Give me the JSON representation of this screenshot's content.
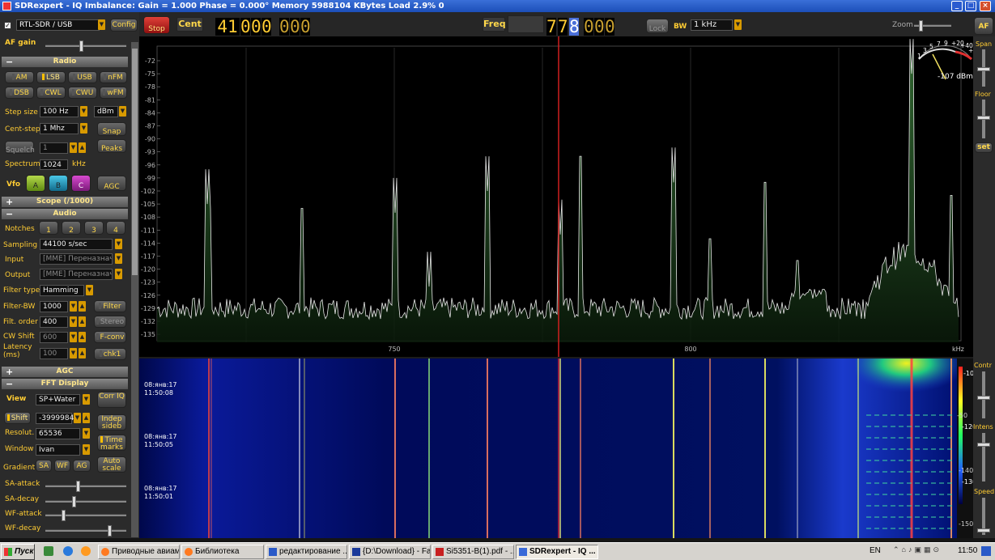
{
  "window": {
    "title": "SDRexpert - IQ Imbalance: Gain = 1.000 Phase = 0.000°   Memory 5988104 KBytes    Load 2.9%  0"
  },
  "toolbar": {
    "device": "RTL-SDR / USB",
    "config": "Config",
    "stop": "Stop",
    "cent_label": "Cent",
    "cent_bright": "41",
    "cent_digits": [
      "0",
      "0",
      "0",
      "0",
      "0",
      "0"
    ],
    "freq_label": "Freq",
    "freq_digits": [
      "7",
      "7",
      "8",
      "0",
      "0",
      "0"
    ],
    "lock": "Lock",
    "bw_label": "BW",
    "bw_value": "1 kHz",
    "zoom_label": "Zoom",
    "af": "AF"
  },
  "left": {
    "af_gain": "AF gain",
    "radio_hdr": "Radio",
    "modes_row1": [
      "AM",
      "LSB",
      "USB",
      "nFM"
    ],
    "modes_row2": [
      "DSB",
      "CWL",
      "CWU",
      "wFM"
    ],
    "step_size_lbl": "Step size",
    "step_size": "100 Hz",
    "unit": "dBm",
    "cent_step_lbl": "Cent-step",
    "cent_step": "1 Mhz",
    "snap": "Snap",
    "squelch": "Squelch",
    "squelch_val": "1",
    "peaks": "Peaks",
    "spectrum_lbl": "Spectrum",
    "spectrum_val": "1024",
    "spectrum_unit": "kHz",
    "vfo_lbl": "Vfo",
    "vfo": [
      "A",
      "B",
      "C"
    ],
    "agc_btn": "AGC",
    "scope_hdr": "Scope (/1000)",
    "audio_hdr": "Audio",
    "notches_lbl": "Notches",
    "notches": [
      "1",
      "2",
      "3",
      "4"
    ],
    "sampling_lbl": "Sampling",
    "sampling": "44100 s/sec",
    "input_lbl": "Input",
    "input": "[MME] Переназнач",
    "output_lbl": "Output",
    "output": "[MME] Переназнач",
    "filter_type_lbl": "Filter type",
    "filter_type": "Hamming",
    "filter_bw_lbl": "Filter-BW",
    "filter_bw": "1000",
    "filter_btn": "Filter",
    "filt_order_lbl": "Filt. order",
    "filt_order": "400",
    "stereo": "Stereo",
    "cw_shift_lbl": "CW Shift",
    "cw_shift": "600",
    "fconv": "F-conv",
    "latency_lbl": "Latency",
    "latency_unit": "(ms)",
    "latency": "100",
    "chk1": "chk1",
    "agc_hdr": "AGC",
    "fft_hdr": "FFT Display",
    "view_lbl": "View",
    "view": "SP+Water",
    "corr_iq": "Corr IQ",
    "shift": "Shift",
    "shift_val": "-3999984",
    "indep": "Indep sideb",
    "resol_lbl": "Resolut.",
    "resol": "65536",
    "time_marks": "Time marks",
    "window_lbl": "Window",
    "window_val": "Ivan",
    "gradient_lbl": "Gradient",
    "gradient": [
      "SA",
      "WF",
      "AG"
    ],
    "auto_scale": "Auto scale",
    "sliders": [
      "SA-attack",
      "SA-decay",
      "WF-attack",
      "WF-decay"
    ]
  },
  "spectrum": {
    "y_ticks": [
      "-72",
      "-75",
      "-78",
      "-81",
      "-84",
      "-87",
      "-90",
      "-93",
      "-96",
      "-99",
      "-102",
      "-105",
      "-108",
      "-111",
      "-114",
      "-117",
      "-120",
      "-123",
      "-126",
      "-129",
      "-132",
      "-135"
    ],
    "x_ticks": [
      "750",
      "800"
    ],
    "x_unit": "kHz",
    "smeter_scale": [
      "1",
      "3",
      "5",
      "7",
      "9",
      "+20",
      "+40",
      "+60"
    ],
    "smeter_reading": "-107 dBm"
  },
  "waterfall": {
    "timestamps": [
      {
        "date": "08:янв:17",
        "time": "11:50:08"
      },
      {
        "date": "08:янв:17",
        "time": "11:50:05"
      },
      {
        "date": "08:янв:17",
        "time": "11:50:01"
      }
    ],
    "scale": [
      "-10",
      "-50",
      "-120",
      "-140",
      "-130",
      "-150",
      "-93"
    ]
  },
  "right": {
    "span": "Span",
    "floor": "Floor",
    "set": "set",
    "contr": "Contr",
    "intens": "Intens",
    "speed": "Speed"
  },
  "taskbar": {
    "start": "Пуск",
    "items": [
      "Приводные авиам...",
      "Библиотека",
      "редактирование ...",
      "{D:\\Download} - Far",
      "Si5351-B(1).pdf - ...",
      "SDRexpert - IQ ..."
    ],
    "lang": "EN",
    "clock": "11:50"
  },
  "colors": {
    "accent": "#ffcc33",
    "freq_highlight": "#4a6fd8",
    "trace": "#e8e8e8",
    "fill": "#1c3a1c",
    "stop": "#c0241c"
  }
}
